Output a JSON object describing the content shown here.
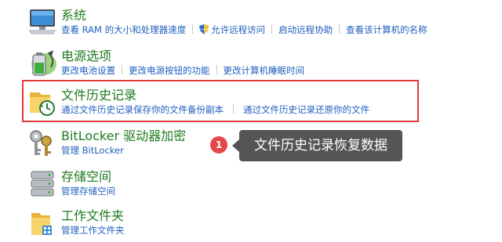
{
  "items": [
    {
      "title": "系统",
      "links": [
        "查看 RAM 的大小和处理器速度",
        "允许远程访问",
        "启动远程协助",
        "查看该计算机的名称"
      ],
      "icon": "computer-icon"
    },
    {
      "title": "电源选项",
      "links": [
        "更改电池设置",
        "更改电源按钮的功能",
        "更改计算机睡眠时间"
      ],
      "icon": "battery-icon"
    },
    {
      "title": "文件历史记录",
      "links": [
        "通过文件历史记录保存你的文件备份副本",
        "通过文件历史记录还原你的文件"
      ],
      "icon": "file-history-icon"
    },
    {
      "title": "BitLocker 驱动器加密",
      "links": [
        "管理 BitLocker"
      ],
      "icon": "bitlocker-keys-icon"
    },
    {
      "title": "存储空间",
      "links": [
        "管理存储空间"
      ],
      "icon": "storage-spaces-icon"
    },
    {
      "title": "工作文件夹",
      "links": [
        "管理工作文件夹"
      ],
      "icon": "work-folders-icon"
    }
  ],
  "annotation": {
    "badge": "1",
    "text": "文件历史记录恢复数据",
    "highlight_color": "#e23a3a",
    "badge_color": "#e5464b",
    "tooltip_color": "#555555"
  },
  "colors": {
    "title": "#1e7a1e",
    "link": "#1f5fbf"
  }
}
